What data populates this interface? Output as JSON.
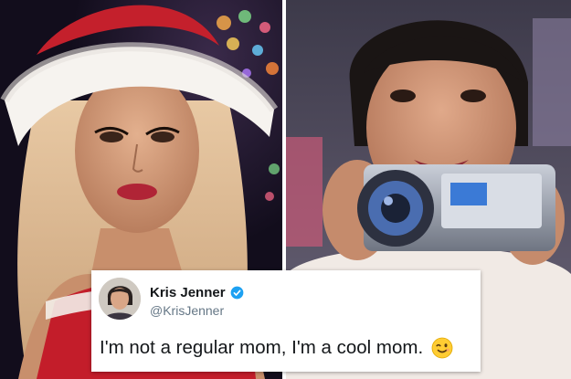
{
  "tweet": {
    "display_name": "Kris Jenner",
    "handle": "@KrisJenner",
    "text": "I'm not a regular mom, I'm a cool mom.",
    "emoji": "wink-emoji-icon",
    "verified": true
  },
  "colors": {
    "divider": "#ffffff",
    "card_background": "#ffffff",
    "name_text": "#14171a",
    "handle_text": "#657786",
    "verified_badge": "#1da1f2",
    "emoji": "#ffcc33"
  }
}
